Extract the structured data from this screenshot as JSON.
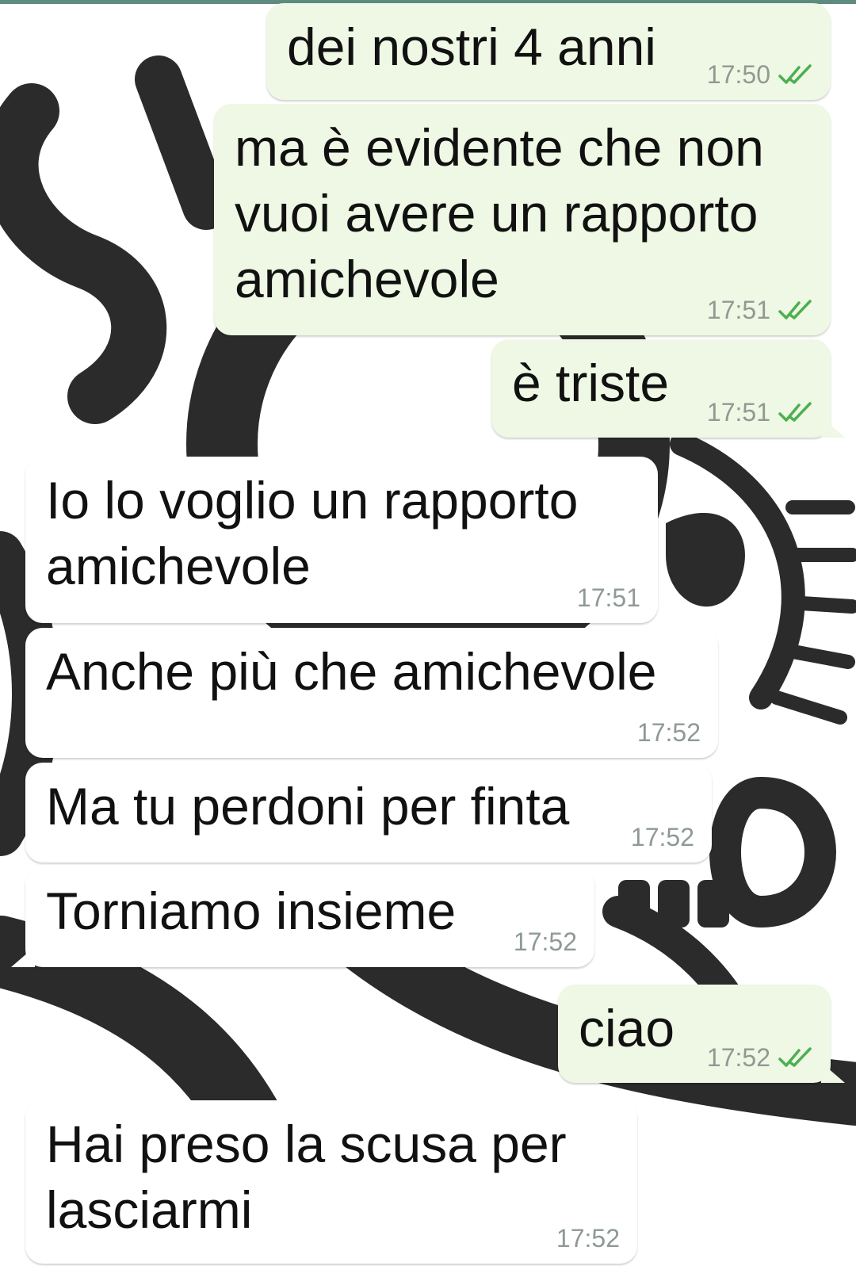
{
  "colors": {
    "outgoing_bubble": "#eef8e4",
    "incoming_bubble": "#ffffff",
    "read_ticks": "#4caf50",
    "timestamp": "#8e9a93",
    "wallpaper_ink": "#2b2b2b"
  },
  "messages": [
    {
      "direction": "out",
      "text": "dei nostri 4 anni",
      "time": "17:50",
      "status": "read-ticks-icon"
    },
    {
      "direction": "out",
      "text": "ma è evidente che non\nvuoi avere un rapporto\namichevole",
      "time": "17:51",
      "status": "read-ticks-icon"
    },
    {
      "direction": "out",
      "text": "è triste",
      "time": "17:51",
      "status": "read-ticks-icon"
    },
    {
      "direction": "in",
      "text": "Io lo voglio un rapporto\namichevole",
      "time": "17:51"
    },
    {
      "direction": "in",
      "text": "Anche più che amichevole",
      "time": "17:52"
    },
    {
      "direction": "in",
      "text": "Ma tu perdoni per finta",
      "time": "17:52"
    },
    {
      "direction": "in",
      "text": "Torniamo insieme",
      "time": "17:52"
    },
    {
      "direction": "out",
      "text": "ciao",
      "time": "17:52",
      "status": "read-ticks-icon"
    },
    {
      "direction": "in",
      "text": "Hai preso la scusa per\nlasciarmi",
      "time": "17:52"
    }
  ]
}
